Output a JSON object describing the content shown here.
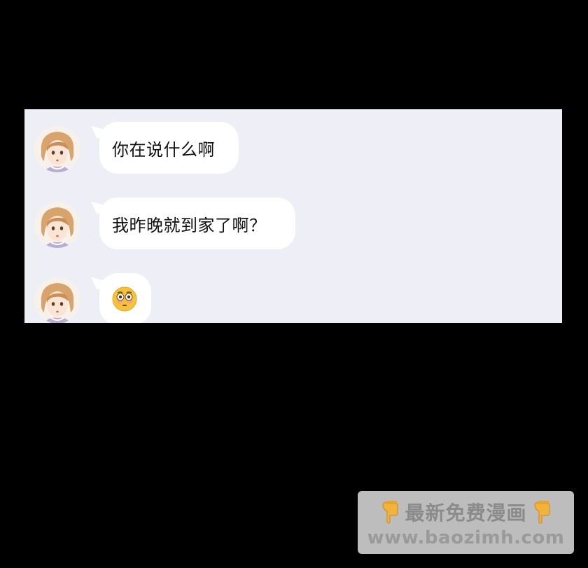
{
  "chat": {
    "messages": [
      {
        "sender_avatar": "girl-avatar",
        "text": "你在说什么啊"
      },
      {
        "sender_avatar": "girl-avatar",
        "text": "我昨晚就到家了啊？"
      },
      {
        "sender_avatar": "girl-avatar",
        "emoji": "flushed-face-emoji"
      }
    ]
  },
  "watermark": {
    "title": "最新免费漫画",
    "url": "www.baozimh.com",
    "icon": "pointing-down-hand-icon"
  },
  "colors": {
    "background": "#000000",
    "panel": "#eeeef6",
    "bubble": "#ffffff",
    "text": "#111111",
    "watermark_bg": "#cdcdcd",
    "watermark_text": "#8b8b8b"
  }
}
